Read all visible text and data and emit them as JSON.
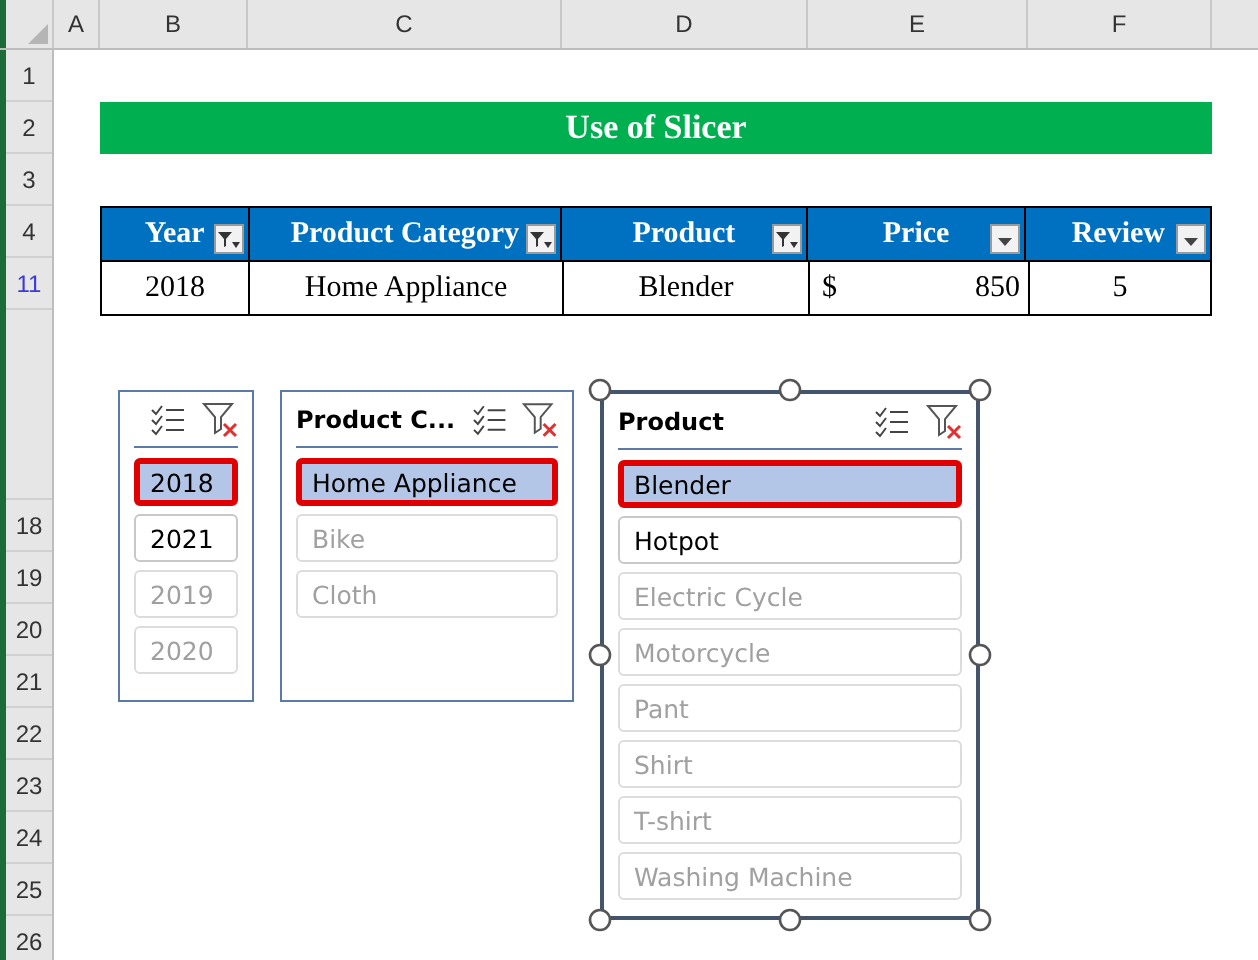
{
  "columns": [
    "A",
    "B",
    "C",
    "D",
    "E",
    "F"
  ],
  "top_rows": [
    {
      "label": "1",
      "filtered": false
    },
    {
      "label": "2",
      "filtered": false
    },
    {
      "label": "3",
      "filtered": false
    },
    {
      "label": "4",
      "filtered": false
    },
    {
      "label": "11",
      "filtered": true
    }
  ],
  "lower_rows": [
    {
      "label": "18",
      "filtered": false
    },
    {
      "label": "19",
      "filtered": false
    },
    {
      "label": "20",
      "filtered": false
    },
    {
      "label": "21",
      "filtered": false
    },
    {
      "label": "22",
      "filtered": false
    },
    {
      "label": "23",
      "filtered": false
    },
    {
      "label": "24",
      "filtered": false
    },
    {
      "label": "25",
      "filtered": false
    },
    {
      "label": "26",
      "filtered": false
    }
  ],
  "title": "Use of Slicer",
  "table": {
    "columns": [
      {
        "label": "Year",
        "filtered": true
      },
      {
        "label": "Product Category",
        "filtered": true
      },
      {
        "label": "Product",
        "filtered": true
      },
      {
        "label": "Price",
        "filtered": false
      },
      {
        "label": "Review",
        "filtered": false
      }
    ],
    "row": {
      "year": "2018",
      "category": "Home Appliance",
      "product": "Blender",
      "currency": "$",
      "price": "850",
      "review": "5"
    }
  },
  "slicers": [
    {
      "active": false,
      "items": [
        {
          "label": "2018",
          "selected": true,
          "available": true
        },
        {
          "label": "2021",
          "selected": false,
          "available": true
        },
        {
          "label": "2019",
          "selected": false,
          "available": false
        },
        {
          "label": "2020",
          "selected": false,
          "available": false
        }
      ]
    },
    {
      "title": "Product C...",
      "active": false,
      "items": [
        {
          "label": "Home Appliance",
          "selected": true,
          "available": true
        },
        {
          "label": "Bike",
          "selected": false,
          "available": false
        },
        {
          "label": "Cloth",
          "selected": false,
          "available": false
        }
      ]
    },
    {
      "title": "Product",
      "active": true,
      "items": [
        {
          "label": "Blender",
          "selected": true,
          "available": true
        },
        {
          "label": "Hotpot",
          "selected": false,
          "available": true
        },
        {
          "label": "Electric Cycle",
          "selected": false,
          "available": false
        },
        {
          "label": "Motorcycle",
          "selected": false,
          "available": false
        },
        {
          "label": "Pant",
          "selected": false,
          "available": false
        },
        {
          "label": "Shirt",
          "selected": false,
          "available": false
        },
        {
          "label": "T-shirt",
          "selected": false,
          "available": false
        },
        {
          "label": "Washing Machine",
          "selected": false,
          "available": false
        }
      ]
    }
  ]
}
